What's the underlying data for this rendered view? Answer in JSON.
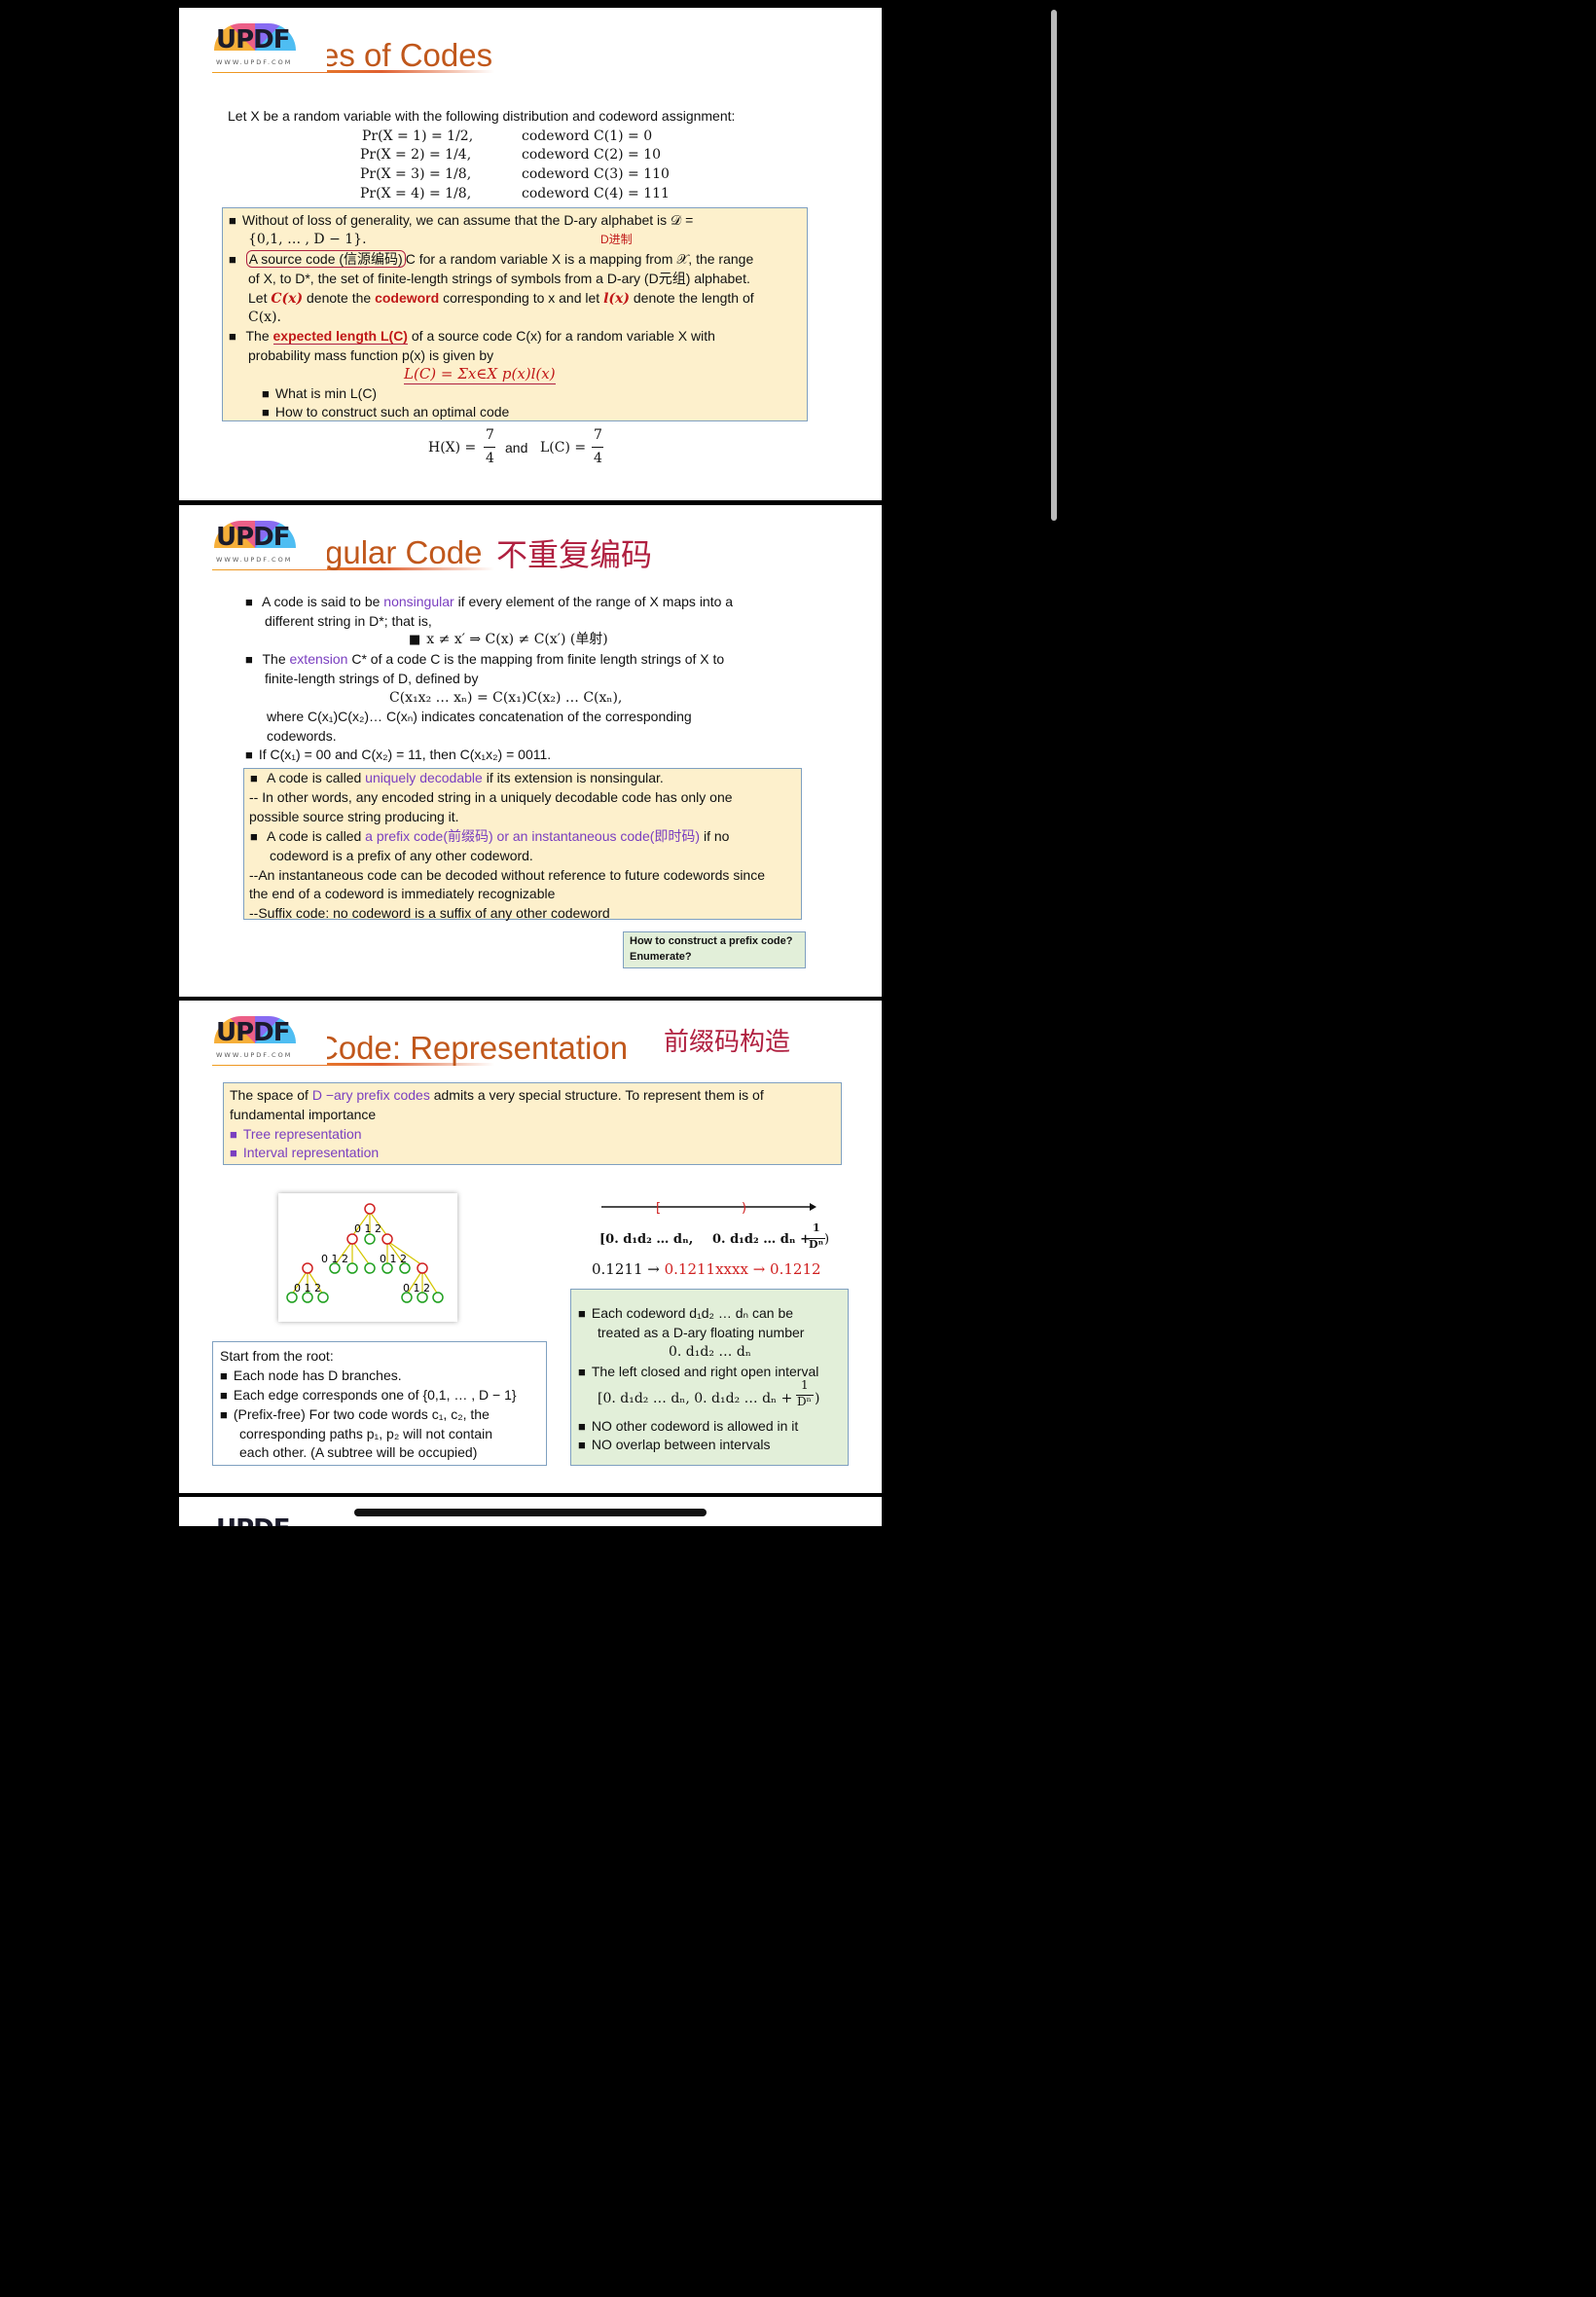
{
  "window": {
    "dots": "•••"
  },
  "logo": {
    "text": "UPDF",
    "url": "WWW.UPDF.COM"
  },
  "slide1": {
    "title": "es of Codes",
    "intro": "Let X be a random variable with the following distribution and codeword assignment:",
    "dist": [
      {
        "p": "Pr(X  =  1) = 1/2,",
        "c": "codeword C(1)  =  0"
      },
      {
        "p": "Pr(X  =  2) = 1/4,",
        "c": "codeword C(2)  =  10"
      },
      {
        "p": "Pr(X  =  3) = 1/8,",
        "c": "codeword C(3)  =  110"
      },
      {
        "p": "Pr(X  =  4) = 1/8,",
        "c": "codeword C(4)  =  111"
      }
    ],
    "b1a": "Without of loss of generality, we can assume that the D-ary alphabet is 𝒟 =",
    "b1b": "{0,1, … , D − 1}.",
    "note_dary": "D进制",
    "b2a_1": "A source code (信源编码)",
    "b2a_2": "C for a random variable X is a mapping from 𝒳, the range",
    "b2b": "of X, to D*, the set of finite-length strings of symbols from a D-ary (D元组) alphabet.",
    "b2c_1": "Let ",
    "b2c_cx": "C(x)",
    "b2c_2": " denote the ",
    "b2c_cw": "codeword",
    "b2c_3": " corresponding to x and let ",
    "b2c_lx": "l(x)",
    "b2c_4": " denote the length of",
    "b2d": "C(x).",
    "b3a_1": "The ",
    "b3a_el": "expected length L(C)",
    "b3a_2": " of a source code C(x) for a random variable X with",
    "b3b": "probability mass function p(x) is given by",
    "formula": "L(C) = Σx∈X p(x)l(x)",
    "sub1": "What is min L(C)",
    "sub2": "How to construct such an optimal code",
    "entropy_lhs": "H(X) =",
    "frac_num": "7",
    "frac_den": "4",
    "and": "and",
    "lc_lhs": "L(C) ="
  },
  "slide2": {
    "title": "gular Code",
    "title_cn": "不重复编码",
    "b1a_1": "A code is said to be ",
    "b1a_kw": "nonsingular",
    "b1a_2": " if every element of the range of X maps into a",
    "b1b": "different string in D*; that is,",
    "b1c": "x ≠ x′ ⇒ C(x) ≠ C(x′)  (单射)",
    "b2a_1": "The ",
    "b2a_kw": "extension",
    "b2a_2": " C* of a code C is the mapping from finite length strings of X to",
    "b2b": "finite-length strings of D, defined by",
    "b2c": "C(x₁x₂ … xₙ) =  C(x₁)C(x₂) …  C(xₙ),",
    "b2d": "where C(x₁)C(x₂)… C(xₙ) indicates concatenation of the corresponding",
    "b2e": "codewords.",
    "b3": "If C(x₁) = 00 and C(x₂) = 11, then C(x₁x₂) = 0011.",
    "box_l1_1": "A code is called ",
    "box_l1_kw": "uniquely decodable",
    "box_l1_2": " if its extension is nonsingular.",
    "box_l2": "-- In other words, any encoded string in a uniquely decodable code has only one",
    "box_l3": "possible source string producing it.",
    "box_l4_1": "A code is called ",
    "box_l4_kw": "a prefix code(前缀码) or an instantaneous code(即时码)",
    "box_l4_2": " if no",
    "box_l5": "codeword is a prefix of any other codeword.",
    "box_l6": "--An instantaneous code can be decoded without reference to future codewords since",
    "box_l7": "the end of a codeword is immediately recognizable",
    "box_l8": "--Suffix code: no codeword is a suffix of any other codeword",
    "q1": "How to construct a prefix code?",
    "q2": "Enumerate?"
  },
  "slide3": {
    "title": "Code: Representation",
    "title_cn": "前缀码构造",
    "intro_1": "The space of ",
    "intro_kw": "D −ary prefix codes",
    "intro_2": " admits a very special structure. To represent them is of",
    "intro_3": "fundamental importance",
    "rep1": "Tree representation",
    "rep2": "Interval representation",
    "tree_label": "0 1 2",
    "interval_left": "[0. d₁d₂ … dₙ,",
    "interval_right": "0. d₁d₂ … dₙ +",
    "interval_num": "1",
    "interval_den": "Dⁿ",
    "interval_close": ")",
    "ex_1": "0.1211 →",
    "ex_2": "0.1211xxxx",
    "ex_3": "→ 0.1212",
    "root_title": "Start from the root:",
    "root_b1": "Each node has D branches.",
    "root_b2": "Each edge corresponds one of {0,1, … , D − 1}",
    "root_b3a": "(Prefix-free) For two code words c₁, c₂, the",
    "root_b3b": "corresponding paths p₁, p₂ will not contain",
    "root_b3c": "each other. (A subtree will be occupied)",
    "g_b1a": "Each codeword d₁d₂ … dₙ can be",
    "g_b1b": "treated as a D-ary floating number",
    "g_b1c": "0. d₁d₂ … dₙ",
    "g_b2a": "The left closed and right open interval",
    "g_b2b": "[0. d₁d₂ … dₙ, 0. d₁d₂ … dₙ +",
    "g_b2num": "1",
    "g_b2den": "Dⁿ",
    "g_b3": "NO other codeword is allowed in it",
    "g_b4": "NO overlap between intervals"
  },
  "slide4": {
    "partial": "UPDF"
  }
}
